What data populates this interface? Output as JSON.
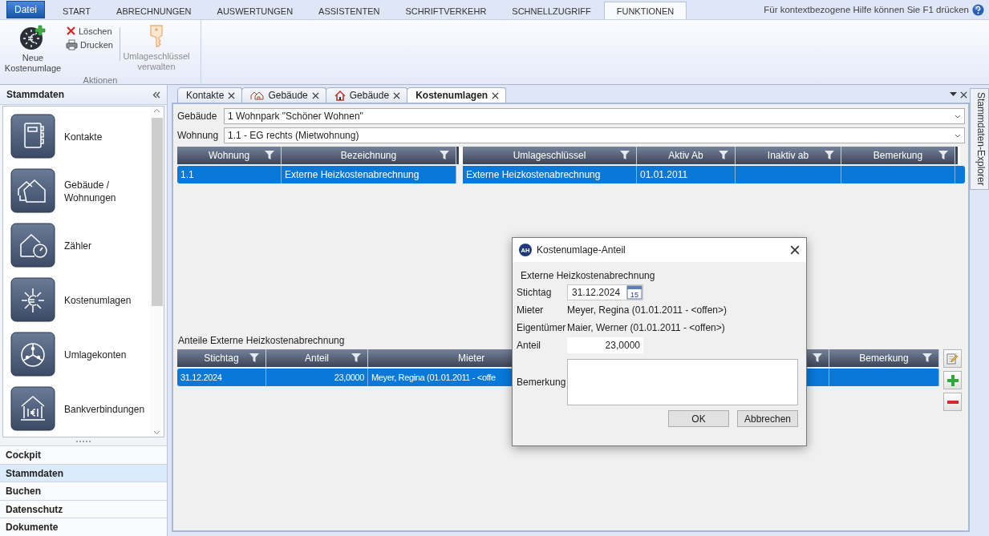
{
  "menu": {
    "file": "Datei",
    "tabs": [
      {
        "label": "START",
        "selected": false
      },
      {
        "label": "ABRECHNUNGEN",
        "selected": false
      },
      {
        "label": "AUSWERTUNGEN",
        "selected": false
      },
      {
        "label": "ASSISTENTEN",
        "selected": false
      },
      {
        "label": "SCHRIFTVERKEHR",
        "selected": false
      },
      {
        "label": "SCHNELLZUGRIFF",
        "selected": false
      },
      {
        "label": "FUNKTIONEN",
        "selected": true
      }
    ],
    "help": "Für kontextbezogene Hilfe können Sie F1 drücken"
  },
  "ribbon": {
    "group_label": "Aktionen",
    "new_allocation": "Neue Kostenumlage",
    "delete": "Löschen",
    "print": "Drucken",
    "manage_keys": {
      "label": "Umlageschlüssel verwalten",
      "disabled": true
    }
  },
  "sidebar": {
    "title": "Stammdaten",
    "items": [
      {
        "label": "Kontakte"
      },
      {
        "label": "Gebäude / Wohnungen"
      },
      {
        "label": "Zähler"
      },
      {
        "label": "Kostenumlagen"
      },
      {
        "label": "Umlagekonten"
      },
      {
        "label": "Bankverbindungen"
      }
    ],
    "sections": [
      {
        "label": "Cockpit",
        "selected": false
      },
      {
        "label": "Stammdaten",
        "selected": true
      },
      {
        "label": "Buchen",
        "selected": false
      },
      {
        "label": "Datenschutz",
        "selected": false
      },
      {
        "label": "Dokumente",
        "selected": false
      }
    ]
  },
  "doc_tabs": [
    {
      "label": "Kontakte",
      "kind": "plain",
      "selected": false
    },
    {
      "label": "Gebäude",
      "kind": "buildings",
      "selected": false
    },
    {
      "label": "Gebäude",
      "kind": "house",
      "selected": false
    },
    {
      "label": "Kostenumlagen",
      "kind": "plain",
      "selected": true
    }
  ],
  "form": {
    "building": {
      "label": "Gebäude",
      "value": "1 Wohnpark \"Schöner Wohnen\""
    },
    "apartment": {
      "label": "Wohnung",
      "value": "1.1 - EG rechts (Mietwohnung)"
    }
  },
  "allocations": {
    "columns": [
      "Wohnung",
      "Bezeichnung",
      "Umlageschlüssel",
      "Aktiv Ab",
      "Inaktiv ab",
      "Bemerkung"
    ],
    "rows": [
      {
        "selected": true,
        "cells": [
          "1.1",
          "Externe Heizkostenabrechnung",
          "Externe Heizkostenabrechnung",
          "01.01.2011"
        ]
      }
    ]
  },
  "shares": {
    "title": "Anteile Externe Heizkostenabrechnung",
    "columns": [
      {
        "label": "Stichtag",
        "kind": "text"
      },
      {
        "label": "Anteil",
        "kind": "number"
      },
      {
        "label": "Mieter",
        "kind": "text"
      },
      {
        "label": "Bemerkung",
        "kind": "text"
      }
    ],
    "rows": [
      {
        "selected": true,
        "cells": [
          "31.12.2024",
          "23,0000",
          "Meyer, Regina (01.01.2011 - <offe"
        ]
      }
    ]
  },
  "explorer_tab": "Stammdaten-Explorer",
  "dialog": {
    "app_icon": "AH",
    "title": "Kostenumlage-Anteil",
    "subtitle": "Externe Heizkostenabrechnung",
    "fields": [
      {
        "kind": "date",
        "label": "Stichtag",
        "value": "31.12.2024",
        "calendar_day": "15"
      },
      {
        "kind": "text",
        "label": "Mieter",
        "value": "Meyer, Regina (01.01.2011 - <offen>)"
      },
      {
        "kind": "text",
        "label": "Eigentümer",
        "value": "Maier, Werner (01.01.2011 - <offen>)"
      },
      {
        "kind": "number",
        "label": "Anteil",
        "value": "23,0000"
      },
      {
        "kind": "memo",
        "label": "Bemerkung"
      }
    ],
    "buttons": [
      "OK",
      "Abbrechen"
    ]
  }
}
